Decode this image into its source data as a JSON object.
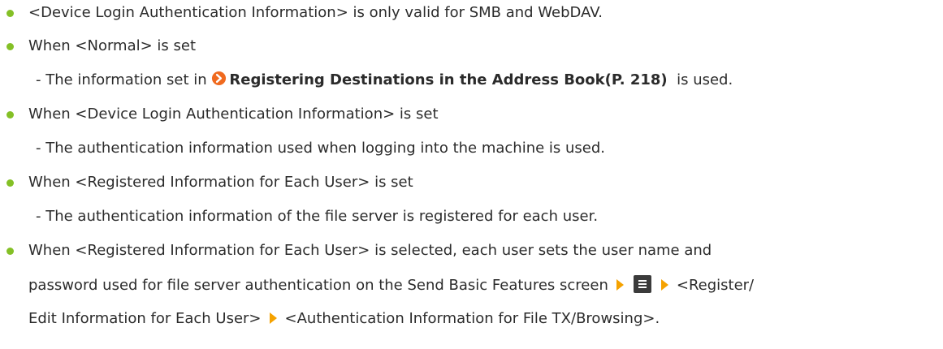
{
  "items": [
    {
      "text": "<Device Login Authentication Information> is only valid for SMB and WebDAV."
    },
    {
      "text": "When <Normal> is set",
      "sub": {
        "prefix": "- The information set in ",
        "link": "Registering Destinations in the Address Book(P. 218)",
        "suffix": "  is used."
      }
    },
    {
      "text": "When <Device Login Authentication Information> is set",
      "sub": {
        "text": "- The authentication information used when logging into the machine is used."
      }
    },
    {
      "text": "When <Registered Information for Each User> is set",
      "sub": {
        "text": "- The authentication information of the file server is registered for each user."
      }
    },
    {
      "line1": "When <Registered Information for Each User> is selected, each user sets the user name and",
      "line2_prefix": "password used for file server authentication on the Send Basic Features screen",
      "line2_suffix": "<Register/",
      "line3_prefix": "Edit Information for Each User>",
      "line3_suffix": "<Authentication Information for File TX/Browsing>."
    }
  ],
  "icons": {
    "link_icon": "circle-arrow-right-icon",
    "step_arrow": "orange-triangle-right-icon",
    "menu": "menu-icon"
  },
  "colors": {
    "bullet": "#84c026",
    "link_icon": "#f06a1f",
    "step_arrow": "#f5a200",
    "text": "#2b2b2b"
  }
}
